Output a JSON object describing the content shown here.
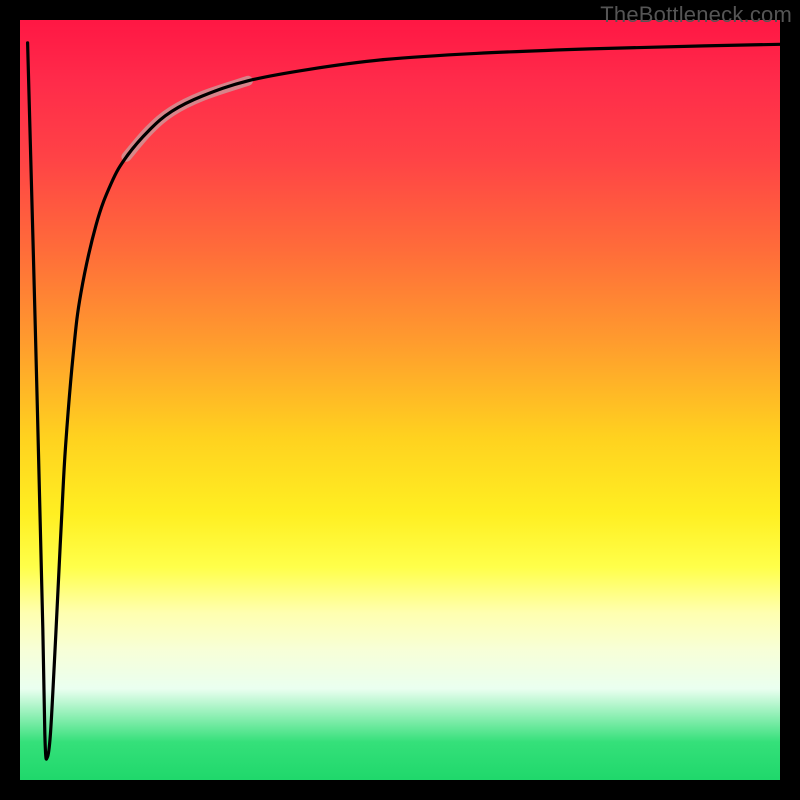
{
  "watermark": "TheBottleneck.com",
  "chart_data": {
    "type": "line",
    "title": "",
    "xlabel": "",
    "ylabel": "",
    "xlim": [
      0,
      100
    ],
    "ylim": [
      0,
      100
    ],
    "gradient_stops": [
      {
        "pos": 0,
        "color": "#ff1744"
      },
      {
        "pos": 30,
        "color": "#ff6b3a"
      },
      {
        "pos": 55,
        "color": "#ffd21f"
      },
      {
        "pos": 75,
        "color": "#ffffb0"
      },
      {
        "pos": 100,
        "color": "#1fd86b"
      }
    ],
    "series": [
      {
        "name": "main-curve",
        "color": "#000000",
        "x": [
          1.0,
          2.0,
          3.0,
          3.3,
          3.6,
          4.0,
          4.5,
          5.0,
          5.5,
          6.0,
          7.0,
          8.0,
          10.0,
          12.0,
          14.0,
          17.0,
          20.0,
          24.0,
          30.0,
          38.0,
          48.0,
          60.0,
          75.0,
          90.0,
          100.0
        ],
        "y": [
          97.0,
          60.0,
          20.0,
          5.0,
          3.0,
          6.0,
          15.0,
          25.0,
          35.0,
          44.0,
          56.0,
          64.0,
          73.0,
          78.5,
          82.0,
          85.5,
          88.0,
          90.0,
          92.0,
          93.5,
          94.8,
          95.6,
          96.2,
          96.6,
          96.8
        ]
      }
    ],
    "highlight_segment": {
      "x_start": 17.0,
      "x_end": 24.0,
      "color": "#c9a0a0",
      "opacity": 0.75
    }
  }
}
